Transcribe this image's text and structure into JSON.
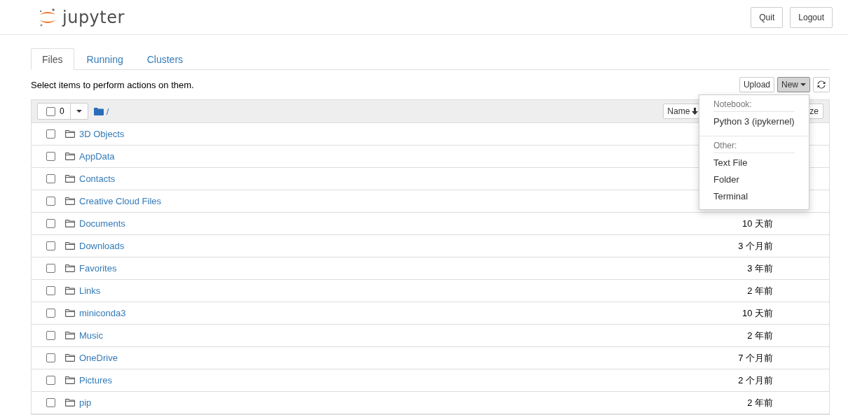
{
  "header": {
    "logo_text": "jupyter",
    "buttons": [
      "Quit",
      "Logout"
    ]
  },
  "tabs": [
    {
      "label": "Files",
      "selected": true
    },
    {
      "label": "Running",
      "selected": false
    },
    {
      "label": "Clusters",
      "selected": false
    }
  ],
  "hint": "Select items to perform actions on them.",
  "toolbar": {
    "upload": "Upload",
    "new": "New"
  },
  "list_header": {
    "select_all_checked": false,
    "selected_count": "0",
    "path": "/",
    "sort_name": "Name",
    "column_3": "ze"
  },
  "new_menu": {
    "sections": [
      {
        "title": "Notebook:",
        "items": [
          "Python 3 (ipykernel)"
        ]
      },
      {
        "title": "Other:",
        "items": [
          "Text File",
          "Folder",
          "Terminal"
        ]
      }
    ]
  },
  "rows": [
    {
      "checked": false,
      "name": "3D Objects"
    },
    {
      "checked": false,
      "name": "AppData"
    },
    {
      "checked": false,
      "name": "Contacts"
    },
    {
      "checked": false,
      "name": "Creative Cloud Files"
    },
    {
      "checked": false,
      "name": "Documents",
      "modified": "10 天前"
    },
    {
      "checked": false,
      "name": "Downloads",
      "modified": "3 个月前"
    },
    {
      "checked": false,
      "name": "Favorites",
      "modified": "3 年前"
    },
    {
      "checked": false,
      "name": "Links",
      "modified": "2 年前"
    },
    {
      "checked": false,
      "name": "miniconda3",
      "modified": "10 天前"
    },
    {
      "checked": false,
      "name": "Music",
      "modified": "2 年前"
    },
    {
      "checked": false,
      "name": "OneDrive",
      "modified": "7 个月前"
    },
    {
      "checked": false,
      "name": "Pictures",
      "modified": "2 个月前"
    },
    {
      "checked": false,
      "name": "pip",
      "modified": "2 年前"
    }
  ]
}
